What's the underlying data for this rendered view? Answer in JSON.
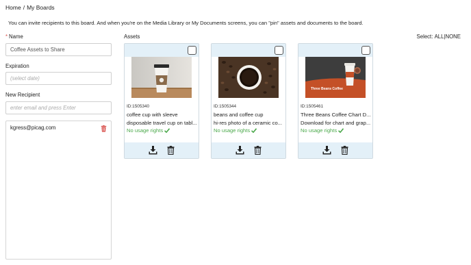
{
  "breadcrumb": {
    "home": "Home",
    "sep": "/",
    "current": "My Boards"
  },
  "intro": "You can invite recipients to this board. And when you're on the Media Library or My Documents screens, you can \"pin\" assets and documents to the board.",
  "form": {
    "name_required_mark": "*",
    "name_label": "Name",
    "name_value": "Coffee Assets to Share",
    "expiration_label": "Expiration",
    "expiration_placeholder": "(select date)",
    "new_recipient_label": "New Recipient",
    "new_recipient_placeholder": "enter email and press Enter"
  },
  "recipients": [
    {
      "email": "kgress@picag.com"
    }
  ],
  "assets_label": "Assets",
  "select": {
    "prefix": "Select: ",
    "all": "ALL",
    "sep": "|",
    "none": "NONE"
  },
  "assets": [
    {
      "id": "ID:1505340",
      "title": "coffee cup with sleeve",
      "description": "disposable travel cup on tabl...",
      "rights": "No usage rights"
    },
    {
      "id": "ID:1505344",
      "title": "beans and coffee cup",
      "description": "hi-res photo of a ceramic co...",
      "rights": "No usage rights"
    },
    {
      "id": "ID:1505461",
      "title": "Three Beans Coffee Chart D...",
      "description": "Download for chart and grap...",
      "rights": "No usage rights",
      "thumb_text": "Three Beans Coffee"
    }
  ],
  "colors": {
    "accent_bar": "#e3f0f8",
    "rights_green": "#4aa84a",
    "delete_red": "#d9534f"
  },
  "icons": {
    "download": "download-icon",
    "delete": "trash-icon",
    "check": "check-icon"
  }
}
